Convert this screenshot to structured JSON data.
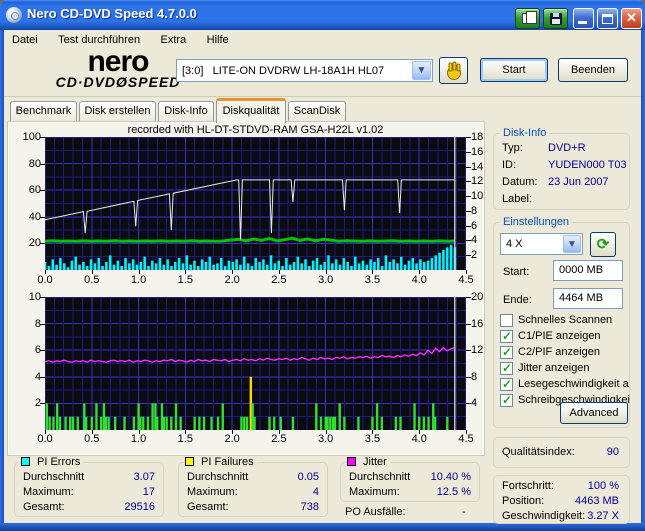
{
  "window": {
    "title": "Nero CD-DVD Speed 4.7.0.0"
  },
  "menu": {
    "items": [
      "Datei",
      "Test durchführen",
      "Extra",
      "Hilfe"
    ]
  },
  "toolbar": {
    "logo_top": "nero",
    "logo_bottom": "CD·DVDØSPEED",
    "drive": "[3:0]   LITE-ON DVDRW LH-18A1H HL07",
    "start_label": "Start",
    "quit_label": "Beenden"
  },
  "tabs": {
    "items": [
      "Benchmark",
      "Disk erstellen",
      "Disk-Info",
      "Diskqualität",
      "ScanDisk"
    ],
    "active": "Diskqualität"
  },
  "disk_info": {
    "title": "Disk-Info",
    "rows": [
      {
        "label": "Typ:",
        "value": "DVD+R"
      },
      {
        "label": "ID:",
        "value": "YUDEN000 T03"
      },
      {
        "label": "Datum:",
        "value": "23 Jun 2007"
      },
      {
        "label": "Label:",
        "value": ""
      }
    ]
  },
  "settings": {
    "title": "Einstellungen",
    "speed_value": "4 X",
    "start_label": "Start:",
    "start_value": "0000 MB",
    "end_label": "Ende:",
    "end_value": "4464 MB",
    "checkboxes": [
      {
        "label": "Schnelles Scannen",
        "checked": false
      },
      {
        "label": "C1/PIE anzeigen",
        "checked": true
      },
      {
        "label": "C2/PIF anzeigen",
        "checked": true
      },
      {
        "label": "Jitter anzeigen",
        "checked": true
      },
      {
        "label": "Lesegeschwindigkeit a",
        "checked": true
      },
      {
        "label": "Schreibgeschwindigkei",
        "checked": true
      }
    ],
    "advanced_label": "Advanced"
  },
  "quality": {
    "label": "Qualitätsindex:",
    "value": "90"
  },
  "progress": {
    "rows": [
      {
        "label": "Fortschritt:",
        "value": "100 %"
      },
      {
        "label": "Position:",
        "value": "4463 MB"
      },
      {
        "label": "Geschwindigkeit:",
        "value": "3.27 X"
      }
    ]
  },
  "stats": {
    "pi_errors": {
      "title": "PI Errors",
      "color": "#00FFFF",
      "rows": [
        {
          "label": "Durchschnitt",
          "value": "3.07"
        },
        {
          "label": "Maximum:",
          "value": "17"
        },
        {
          "label": "Gesamt:",
          "value": "29516"
        }
      ]
    },
    "pi_failures": {
      "title": "PI Failures",
      "color": "#FFFF00",
      "rows": [
        {
          "label": "Durchschnitt",
          "value": "0.05"
        },
        {
          "label": "Maximum:",
          "value": "4"
        },
        {
          "label": "Gesamt:",
          "value": "738"
        }
      ]
    },
    "jitter": {
      "title": "Jitter",
      "color": "#FF00FF",
      "rows": [
        {
          "label": "Durchschnitt",
          "value": "10.40 %"
        },
        {
          "label": "Maximum:",
          "value": "12.5 %"
        }
      ]
    },
    "po_label": "PO Ausfälle:",
    "po_value": "-"
  },
  "chart_data": [
    {
      "type": "area",
      "title": "recorded with HL-DT-STDVD-RAM GSA-H22L v1.02",
      "x_range": [
        0,
        4.5
      ],
      "x_ticks": [
        "0.0",
        "0.5",
        "1.0",
        "1.5",
        "2.0",
        "2.5",
        "3.0",
        "3.5",
        "4.0",
        "4.5"
      ],
      "left_range": [
        0,
        100
      ],
      "left_ticks": [
        100,
        80,
        60,
        40,
        20
      ],
      "right_range": [
        0,
        18
      ],
      "right_ticks": [
        18,
        16,
        14,
        12,
        10,
        8,
        6,
        4,
        2
      ],
      "cursor_x": 4.38,
      "grid": {
        "h_minor": 10,
        "h_major": 20,
        "v_minor": 0.1,
        "v_major": 0.5
      },
      "series": [
        {
          "name": "pi-errors-samples",
          "legend": "C1/PIE",
          "type": "bars",
          "scale": "left",
          "color": "#00F2FF",
          "values": [
            6,
            3,
            8,
            4,
            9,
            5,
            2,
            7,
            10,
            4,
            6,
            3,
            8,
            5,
            9,
            3,
            6,
            11,
            4,
            7,
            3,
            9,
            5,
            8,
            4,
            6,
            10,
            3,
            7,
            5,
            9,
            4,
            8,
            3,
            6,
            9,
            5,
            11,
            4,
            7,
            3,
            8,
            6,
            10,
            4,
            5,
            9,
            3,
            7,
            6,
            8,
            4,
            10,
            5,
            3,
            9,
            6,
            8,
            4,
            11,
            5,
            7,
            3,
            9,
            4,
            6,
            10,
            5,
            8,
            3,
            7,
            9,
            4,
            6,
            11,
            5,
            8,
            4,
            9,
            6,
            3,
            10,
            5,
            7,
            4,
            8,
            6,
            9,
            3,
            11,
            6,
            8,
            5,
            10,
            4,
            7,
            9,
            5,
            8,
            6,
            7,
            9,
            11,
            13,
            15,
            17,
            19,
            17
          ]
        },
        {
          "name": "scan-speed-line",
          "legend": "Lesegeschwindigkeit",
          "type": "line",
          "scale": "right",
          "color": "#00C400",
          "width": 3,
          "values": [
            3.9,
            3.95,
            3.88,
            3.92,
            3.9,
            3.94,
            3.89,
            3.93,
            3.9,
            3.95,
            3.88,
            3.92,
            3.9,
            3.93,
            3.89,
            3.94,
            3.9,
            3.92,
            3.88,
            3.95,
            3.9,
            3.93,
            3.89,
            3.92,
            4.05,
            4.15,
            3.95,
            4.2,
            4.0,
            4.25,
            3.95,
            4.1,
            4.3,
            4.0,
            4.2,
            3.95,
            4.15,
            4.05,
            3.9,
            3.95,
            3.92,
            3.9,
            3.94,
            3.9,
            3.92,
            3.95,
            3.9,
            3.93,
            3.9,
            3.92,
            3.9,
            3.94,
            3.9,
            3.92
          ]
        },
        {
          "name": "write-speed-line",
          "legend": "Schreibgeschwindigkeit",
          "type": "line",
          "scale": "right",
          "color": "#E8E8E8",
          "width": 1,
          "points": [
            [
              0,
              6.8
            ],
            [
              0.41,
              7.9
            ],
            [
              0.43,
              5.0
            ],
            [
              0.45,
              7.95
            ],
            [
              0.95,
              9.3
            ],
            [
              0.97,
              5.9
            ],
            [
              0.99,
              9.4
            ],
            [
              1.33,
              10.3
            ],
            [
              1.35,
              5.4
            ],
            [
              1.37,
              10.4
            ],
            [
              2.05,
              12.2
            ],
            [
              2.07,
              12.2
            ],
            [
              2.09,
              4.1
            ],
            [
              2.11,
              12.2
            ],
            [
              2.4,
              12.2
            ],
            [
              2.42,
              5.0
            ],
            [
              2.44,
              12.2
            ],
            [
              2.63,
              12.2
            ],
            [
              2.65,
              9.2
            ],
            [
              2.67,
              12.2
            ],
            [
              3.18,
              12.2
            ],
            [
              3.2,
              8.1
            ],
            [
              3.22,
              12.2
            ],
            [
              3.77,
              12.2
            ],
            [
              3.79,
              7.7
            ],
            [
              3.81,
              12.2
            ],
            [
              4.38,
              12.2
            ]
          ]
        }
      ]
    },
    {
      "type": "mixed",
      "title": "",
      "x_range": [
        0,
        4.5
      ],
      "x_ticks": [
        "0.0",
        "0.5",
        "1.0",
        "1.5",
        "2.0",
        "2.5",
        "3.0",
        "3.5",
        "4.0",
        "4.5"
      ],
      "left_range": [
        0,
        10
      ],
      "left_ticks": [
        10,
        8,
        6,
        4,
        2
      ],
      "right_range": [
        0,
        20
      ],
      "right_ticks": [
        20,
        16,
        12,
        8,
        4
      ],
      "cursor_x": 4.38,
      "grid": {
        "h_minor": 1,
        "h_major": 2,
        "v_minor": 0.1,
        "v_major": 0.5
      },
      "series": [
        {
          "name": "pi-failures-bars",
          "legend": "C2/PIF",
          "type": "vbars",
          "scale": "left",
          "colors": {
            "g": "#33DD33",
            "y": "#FFD800"
          },
          "bars": [
            [
              0.02,
              2
            ],
            [
              0.05,
              1
            ],
            [
              0.09,
              1
            ],
            [
              0.13,
              2
            ],
            [
              0.16,
              1
            ],
            [
              0.22,
              1
            ],
            [
              0.27,
              1
            ],
            [
              0.3,
              1
            ],
            [
              0.35,
              1
            ],
            [
              0.42,
              2
            ],
            [
              0.44,
              1
            ],
            [
              0.5,
              1
            ],
            [
              0.55,
              2
            ],
            [
              0.6,
              1
            ],
            [
              0.63,
              2
            ],
            [
              0.65,
              1
            ],
            [
              0.68,
              1
            ],
            [
              0.75,
              1
            ],
            [
              0.85,
              1
            ],
            [
              0.95,
              1
            ],
            [
              1.0,
              2
            ],
            [
              1.02,
              1
            ],
            [
              1.05,
              1
            ],
            [
              1.1,
              1
            ],
            [
              1.15,
              2
            ],
            [
              1.18,
              2
            ],
            [
              1.2,
              1
            ],
            [
              1.25,
              2
            ],
            [
              1.27,
              1
            ],
            [
              1.3,
              1
            ],
            [
              1.35,
              1
            ],
            [
              1.4,
              2
            ],
            [
              1.45,
              1
            ],
            [
              1.6,
              1
            ],
            [
              1.65,
              1
            ],
            [
              1.7,
              1
            ],
            [
              1.78,
              1
            ],
            [
              1.85,
              1
            ],
            [
              1.9,
              2
            ],
            [
              2.1,
              1
            ],
            [
              2.13,
              1
            ],
            [
              2.16,
              1
            ],
            [
              2.2,
              4,
              "y"
            ],
            [
              2.22,
              2
            ],
            [
              2.24,
              1
            ],
            [
              2.4,
              1
            ],
            [
              2.45,
              1
            ],
            [
              2.52,
              1
            ],
            [
              2.65,
              1
            ],
            [
              2.9,
              2
            ],
            [
              2.95,
              1
            ],
            [
              3.0,
              1
            ],
            [
              3.02,
              1
            ],
            [
              3.05,
              1
            ],
            [
              3.08,
              1
            ],
            [
              3.1,
              1
            ],
            [
              3.15,
              2
            ],
            [
              3.2,
              1
            ],
            [
              3.35,
              1
            ],
            [
              3.5,
              1
            ],
            [
              3.55,
              2
            ],
            [
              3.6,
              1
            ],
            [
              3.75,
              1
            ],
            [
              3.8,
              1
            ],
            [
              3.95,
              2
            ],
            [
              4.0,
              1
            ],
            [
              4.05,
              1
            ],
            [
              4.1,
              1
            ],
            [
              4.15,
              2
            ],
            [
              4.17,
              1
            ],
            [
              4.3,
              1
            ]
          ]
        },
        {
          "name": "jitter-line",
          "legend": "Jitter",
          "type": "line",
          "scale": "right",
          "color": "#FF30FF",
          "width": 1.3,
          "values": [
            10.3,
            10.4,
            10.2,
            10.4,
            10.3,
            10.5,
            10.3,
            10.2,
            10.4,
            10.3,
            10.4,
            10.2,
            10.5,
            10.3,
            10.4,
            10.3,
            10.2,
            10.4,
            10.5,
            10.3,
            10.4,
            10.3,
            10.5,
            10.2,
            10.4,
            10.3,
            10.5,
            10.4,
            10.2,
            10.4,
            10.3,
            10.5,
            10.4,
            10.6,
            10.3,
            10.5,
            10.4,
            10.2,
            10.5,
            10.3,
            10.6,
            10.4,
            10.5,
            10.3,
            10.6,
            10.5,
            10.4,
            10.6,
            10.3,
            10.5,
            10.6,
            10.4,
            10.7,
            10.5,
            10.6,
            10.4,
            10.7,
            10.5,
            10.8,
            10.6,
            10.5,
            10.7,
            10.6,
            10.8,
            10.5,
            10.7,
            10.6,
            10.9,
            10.7,
            10.5,
            10.8,
            10.6,
            10.9,
            10.7,
            10.8,
            10.6,
            10.9,
            10.8,
            11.0,
            10.7,
            10.9,
            10.8,
            11.0,
            10.9,
            11.1,
            10.8,
            11.0,
            10.9,
            11.2,
            11.0,
            11.1,
            10.9,
            11.2,
            11.0,
            11.3,
            11.1,
            11.4,
            11.2,
            11.6,
            11.3,
            12.0,
            11.5,
            12.3,
            11.8,
            12.4,
            11.9,
            12.2,
            12.4
          ]
        }
      ]
    }
  ]
}
